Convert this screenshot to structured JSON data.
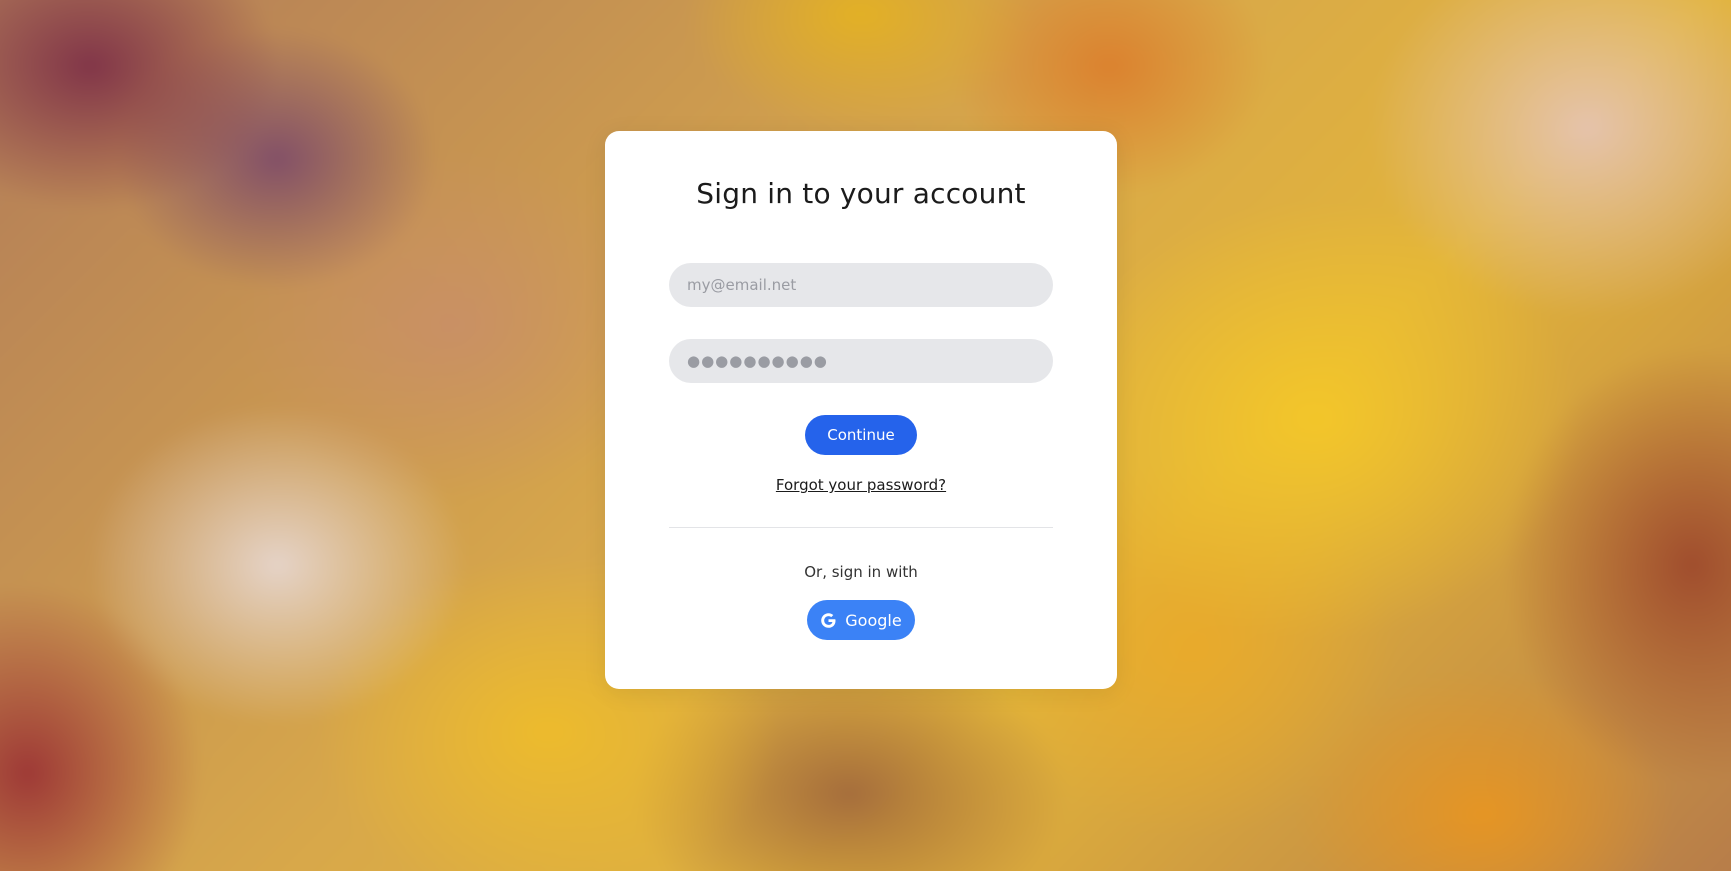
{
  "login": {
    "title": "Sign in to your account",
    "email_placeholder": "my@email.net",
    "password_placeholder": "●●●●●●●●●●",
    "continue_label": "Continue",
    "forgot_label": "Forgot your password?",
    "or_label": "Or, sign in with",
    "google_label": "Google",
    "google_icon": "google-icon"
  },
  "colors": {
    "primary": "#2563eb",
    "google": "#3b82f6",
    "field_bg": "#e6e7ea"
  }
}
